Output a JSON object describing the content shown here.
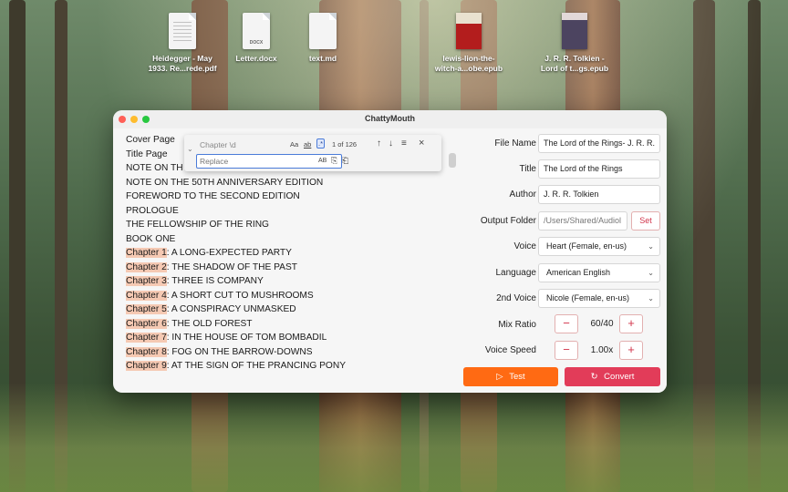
{
  "desktop": {
    "icons": [
      {
        "label_line1": "Heidegger - May",
        "label_line2": "1933. Re...rede.pdf"
      },
      {
        "label_line1": "Letter.docx",
        "label_line2": "",
        "badge": "DOCX"
      },
      {
        "label_line1": "text.md",
        "label_line2": ""
      },
      {
        "label_line1": "lewis-lion-the-",
        "label_line2": "witch-a...obe.epub"
      },
      {
        "label_line1": "J. R. R. Tolkien -",
        "label_line2": "Lord of t...gs.epub"
      }
    ]
  },
  "window": {
    "title": "ChattyMouth",
    "traffic_colors": [
      "#ff5f57",
      "#febc2e",
      "#28c840"
    ]
  },
  "editor": {
    "lines": [
      {
        "prefix": "",
        "text": "Cover Page"
      },
      {
        "prefix": "",
        "text": "Title Page"
      },
      {
        "prefix": "",
        "text": "NOTE ON TH"
      },
      {
        "prefix": "",
        "text": "NOTE ON THE 50TH ANNIVERSARY EDITION"
      },
      {
        "prefix": "",
        "text": "FOREWORD TO THE SECOND EDITION"
      },
      {
        "prefix": "",
        "text": "PROLOGUE"
      },
      {
        "prefix": "",
        "text": "THE FELLOWSHIP OF THE RING"
      },
      {
        "prefix": "",
        "text": "BOOK ONE"
      },
      {
        "prefix": "Chapter 1",
        "text": ": A LONG-EXPECTED PARTY"
      },
      {
        "prefix": "Chapter 2",
        "text": ": THE SHADOW OF THE PAST"
      },
      {
        "prefix": "Chapter 3",
        "text": ": THREE IS COMPANY"
      },
      {
        "prefix": "Chapter 4",
        "text": ": A SHORT CUT TO MUSHROOMS"
      },
      {
        "prefix": "Chapter 5",
        "text": ": A CONSPIRACY UNMASKED"
      },
      {
        "prefix": "Chapter 6",
        "text": ": THE OLD FOREST"
      },
      {
        "prefix": "Chapter 7",
        "text": ": IN THE HOUSE OF TOM BOMBADIL"
      },
      {
        "prefix": "Chapter 8",
        "text": ": FOG ON THE BARROW-DOWNS"
      },
      {
        "prefix": "Chapter 9",
        "text": ": AT THE SIGN OF THE PRANCING PONY"
      }
    ],
    "highlight_color": "#f5c9b3"
  },
  "find": {
    "search_value": "Chapter \\d",
    "replace_placeholder": "Replace",
    "match_case": "Aa",
    "whole_word": "ab",
    "regex": ".*",
    "count": "1 of 126",
    "prev": "↑",
    "next": "↓",
    "selection": "≡",
    "close": "×",
    "preserve_case": "AB",
    "replace_one": "⎘",
    "replace_all": "⎗"
  },
  "form": {
    "file_name": {
      "label": "File Name",
      "value": "The Lord of the Rings- J. R. R."
    },
    "title": {
      "label": "Title",
      "value": "The Lord of the Rings"
    },
    "author": {
      "label": "Author",
      "value": "J. R. R. Tolkien"
    },
    "output_folder": {
      "label": "Output Folder",
      "value": "/Users/Shared/Audiol",
      "button": "Set"
    },
    "voice": {
      "label": "Voice",
      "value": "Heart (Female, en-us)"
    },
    "language": {
      "label": "Language",
      "value": "American English"
    },
    "second_voice": {
      "label": "2nd Voice",
      "value": "Nicole (Female, en-us)"
    },
    "mix_ratio": {
      "label": "Mix Ratio",
      "value": "60/40"
    },
    "voice_speed": {
      "label": "Voice Speed",
      "value": "1.00x"
    },
    "minus": "−",
    "plus": "+",
    "chevron": "⌄"
  },
  "actions": {
    "test": {
      "icon": "▷",
      "label": "Test",
      "color": "#ff6a13"
    },
    "convert": {
      "icon": "↻",
      "label": "Convert",
      "color": "#e23c59"
    }
  }
}
